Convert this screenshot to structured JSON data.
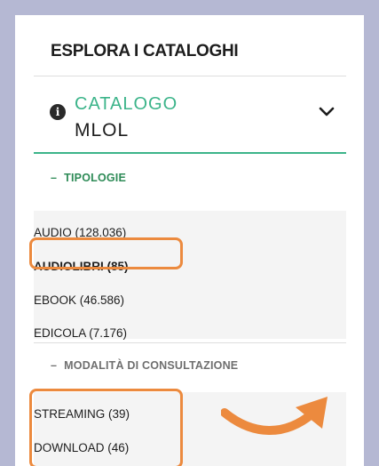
{
  "panel": {
    "title": "ESPLORA I CATALOGHI"
  },
  "catalog": {
    "label": "CATALOGO",
    "value": "MLOL",
    "info_icon": "info-icon",
    "toggle_icon": "chevron-down-icon"
  },
  "tipologie": {
    "header": "TIPOLOGIE",
    "dash": "–",
    "items": [
      {
        "label": "AUDIO (128.036)",
        "active": false
      },
      {
        "label": "AUDIOLIBRI (85)",
        "active": true
      },
      {
        "label": "EBOOK (46.586)",
        "active": false
      },
      {
        "label": "EDICOLA (7.176)",
        "active": false
      }
    ]
  },
  "modalita": {
    "header": "MODALITÀ DI CONSULTAZIONE",
    "dash": "–",
    "items": [
      {
        "label": "STREAMING (39)"
      },
      {
        "label": "DOWNLOAD (46)"
      }
    ]
  },
  "colors": {
    "accent": "#3cb48a",
    "section_green": "#2e8b57",
    "highlight": "#ec8a3e",
    "backdrop": "#b5b8d3"
  }
}
